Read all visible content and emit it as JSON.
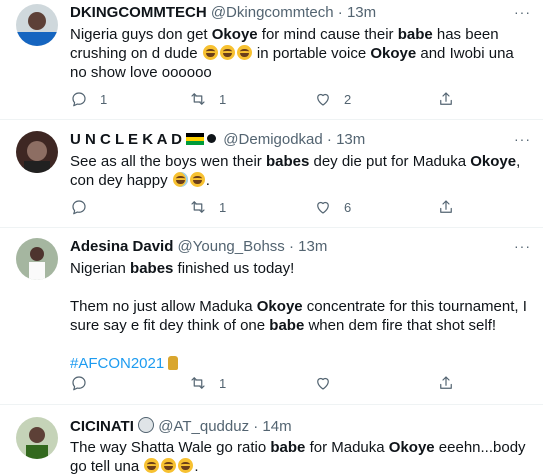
{
  "tweets": [
    {
      "name": "DKINGCOMMTECH",
      "handle": "@Dkingcommtech",
      "time": "13m",
      "more": "···",
      "text_parts": [
        "Nigeria guys don get ",
        "Okoye",
        " for mind cause their ",
        "babe",
        " has been crushing on d dude ",
        " in portable voice ",
        "Okoye",
        " and Iwobi una no show love oooooo"
      ],
      "replies": "1",
      "retweets": "1",
      "likes": "2"
    },
    {
      "name": "U N C L E K A D",
      "handle": "@Demigodkad",
      "time": "13m",
      "more": "···",
      "text_parts": [
        "See as all the boys wen their ",
        "babes",
        " dey die put for Maduka ",
        "Okoye",
        ", con dey happy "
      ],
      "replies": "",
      "retweets": "1",
      "likes": "6"
    },
    {
      "name": "Adesina David",
      "handle": "@Young_Bohss",
      "time": "13m",
      "more": "···",
      "text_parts": [
        "Nigerian ",
        "babes",
        " finished us today!",
        "Them no just allow Maduka ",
        "Okoye",
        " concentrate for this tournament, I sure say e fit dey think of one ",
        "babe",
        " when dem fire that shot self!"
      ],
      "hashtag": "#AFCON2021",
      "replies": "",
      "retweets": "1",
      "likes": ""
    },
    {
      "name": "CICINATI",
      "handle": "@AT_qudduz",
      "time": "14m",
      "more": "",
      "text_parts": [
        "The way Shatta Wale go ratio ",
        "babe",
        " for Maduka ",
        "Okoye",
        " eeehn...body go tell una "
      ],
      "replies": "",
      "retweets": "",
      "likes": ""
    }
  ],
  "separator": "·",
  "icons": [
    "reply-icon",
    "retweet-icon",
    "like-icon",
    "share-icon",
    "more-icon"
  ],
  "colors": {
    "text": "#0f1419",
    "muted": "#536471",
    "link": "#1d9bf0",
    "border": "#eff3f4"
  }
}
